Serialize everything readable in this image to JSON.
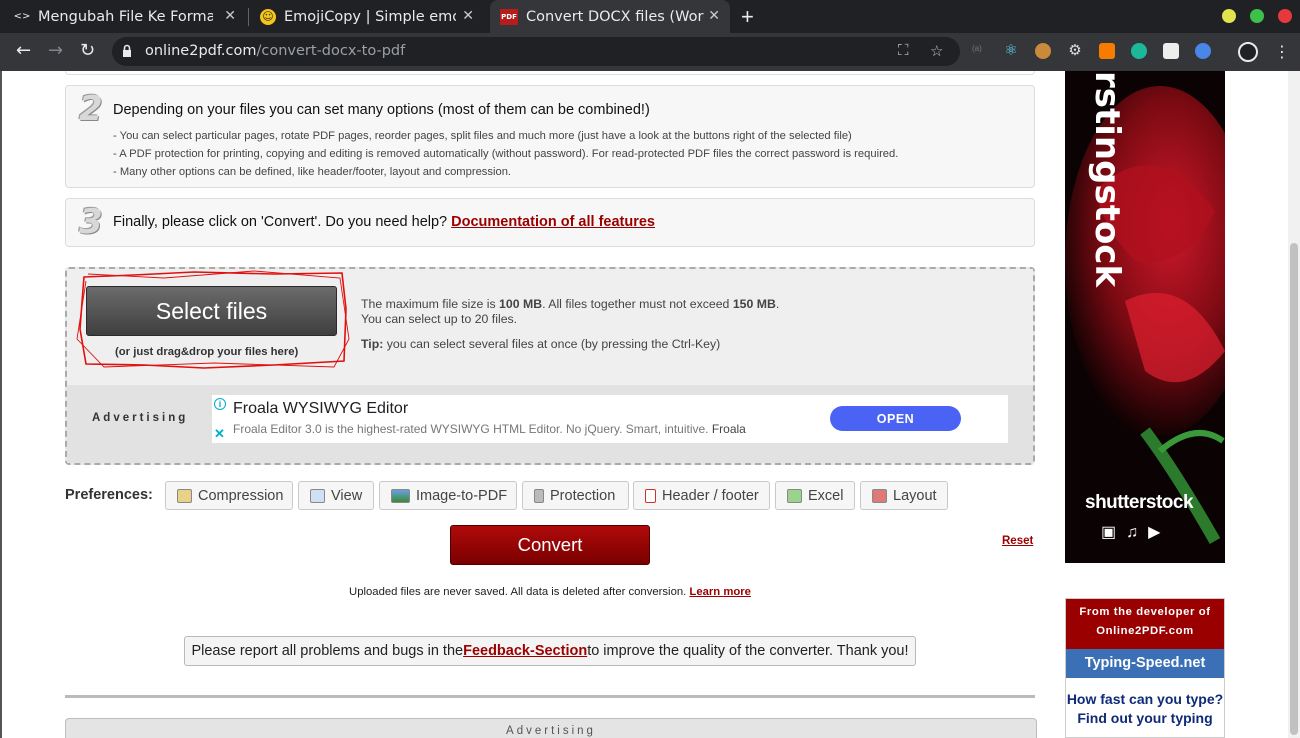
{
  "browser": {
    "tabs": [
      {
        "title": "Mengubah File Ke Format",
        "icon": "code-icon"
      },
      {
        "title": "EmojiCopy | Simple emoji",
        "icon": "emoji-icon"
      },
      {
        "title": "Convert DOCX files (Word",
        "icon": "pdf-icon",
        "icon_text": "PDF",
        "active": true
      }
    ],
    "newtab_label": "+",
    "url_host": "online2pdf.com",
    "url_path": "/convert-docx-to-pdf"
  },
  "steps": {
    "step2": {
      "number": "2",
      "title": "Depending on your files you can set many options (most of them can be combined!)",
      "lines": [
        "- You can select particular pages, rotate PDF pages, reorder pages, split files and much more (just have a look at the buttons right of the selected file)",
        "- A PDF protection for printing, copying and editing is removed automatically (without password). For read-protected PDF files the correct password is required.",
        "- Many other options can be defined, like header/footer, layout and compression."
      ]
    },
    "step3": {
      "number": "3",
      "title": "Finally, please click on 'Convert'. Do you need help?",
      "link": "Documentation of all features"
    }
  },
  "upload": {
    "select_label": "Select files",
    "drag_hint": "(or just drag&drop your files here)",
    "info1_a": "The maximum file size is ",
    "info1_b": "100 MB",
    "info1_c": ". All files together must not exceed ",
    "info1_d": "150 MB",
    "info1_e": ".",
    "info2": "You can select up to 20 files.",
    "tip_label": "Tip:",
    "tip_text": " you can select several files at once (by pressing the Ctrl-Key)"
  },
  "ad": {
    "label": "Advertising",
    "title": "Froala WYSIWYG Editor",
    "desc": "Froala Editor 3.0 is the highest-rated WYSIWYG HTML Editor. No jQuery. Smart, intuitive.",
    "brand": "Froala",
    "cta": "OPEN"
  },
  "preferences": {
    "label": "Preferences:",
    "items": [
      "Compression",
      "View",
      "Image-to-PDF",
      "Protection",
      "Header / footer",
      "Excel",
      "Layout"
    ]
  },
  "convert_label": "Convert",
  "reset_label": "Reset",
  "privacy": {
    "text": "Uploaded files are never saved. All data is deleted after conversion.",
    "link": "Learn more"
  },
  "feedback": {
    "pre": "Please report all problems and bugs in the ",
    "link": "Feedback-Section",
    "post": " to improve the quality of the converter. Thank you!"
  },
  "bottom_ad_label": "Advertising",
  "side_ad": {
    "vertical_text": "rstingstοck",
    "brand": "shutterstοck",
    "icons": "▣♫▶"
  },
  "dev_box": {
    "header": "From the developer of Online2PDF.com",
    "product": "Typing-Speed.net",
    "question": "How fast can you type?",
    "more": "Find out your typing"
  },
  "colors": {
    "brand_red": "#9b0000",
    "ad_button": "#4a63f5",
    "typing_blue": "#3b70b6"
  }
}
